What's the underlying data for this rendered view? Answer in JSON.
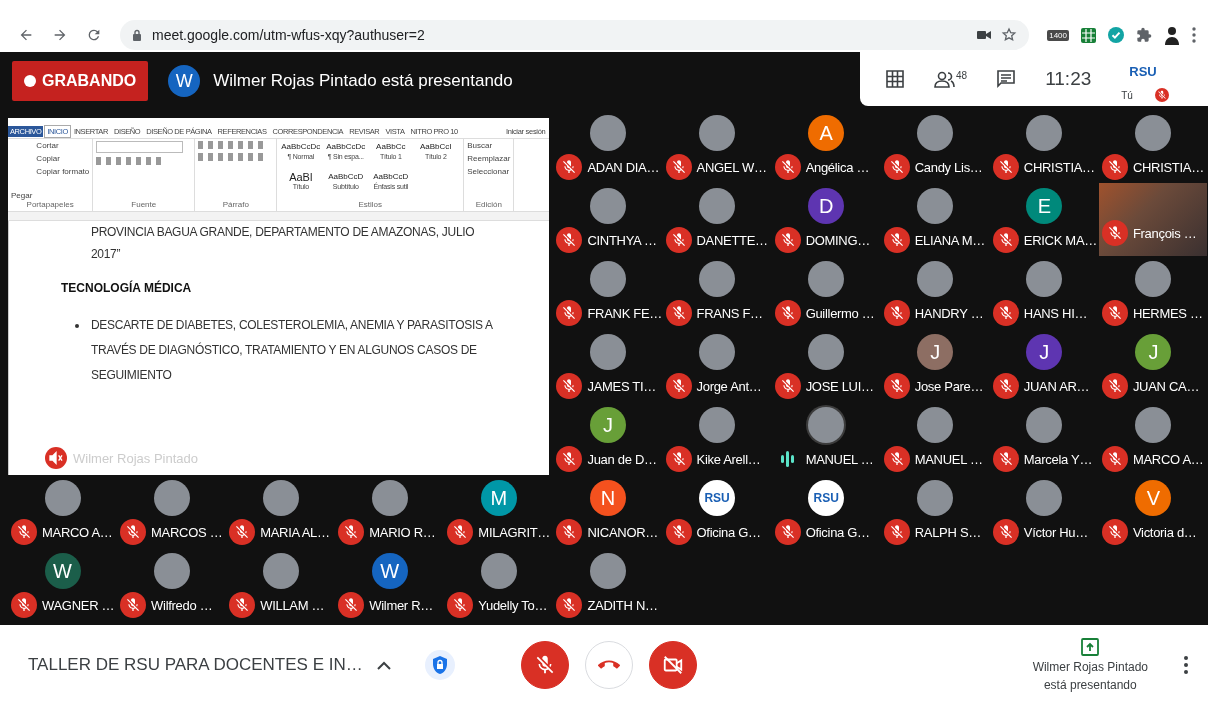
{
  "browser": {
    "url": "meet.google.com/utm-wfus-xqy?authuser=2",
    "extension_badge": "1400"
  },
  "header": {
    "recording_label": "GRABANDO",
    "presenter_initial": "W",
    "presenting_text": "Wilmer Rojas Pintado está presentando",
    "people_count": "48",
    "time": "11:23",
    "self_logo": "RSU",
    "self_label": "Tú",
    "self_muted": true
  },
  "presentation": {
    "tabs": [
      {
        "label": "ARCHIVO",
        "kind": "backstage",
        "selected": false
      },
      {
        "label": "INICIO",
        "kind": "tab",
        "selected": true
      },
      {
        "label": "INSERTAR",
        "kind": "tab",
        "selected": false
      },
      {
        "label": "DISEÑO",
        "kind": "tab",
        "selected": false
      },
      {
        "label": "DISEÑO DE PÁGINA",
        "kind": "tab",
        "selected": false
      },
      {
        "label": "REFERENCIAS",
        "kind": "tab",
        "selected": false
      },
      {
        "label": "CORRESPONDENCIA",
        "kind": "tab",
        "selected": false
      },
      {
        "label": "REVISAR",
        "kind": "tab",
        "selected": false
      },
      {
        "label": "VISTA",
        "kind": "tab",
        "selected": false
      },
      {
        "label": "NITRO PRO 10",
        "kind": "tab",
        "selected": false
      }
    ],
    "sign_in": "Iniciar sesión",
    "clipboard": {
      "paste": "Pegar",
      "items": [
        "Cortar",
        "Copiar",
        "Copiar formato"
      ]
    },
    "styles": [
      {
        "sample": "AaBbCcDc",
        "name": "¶ Normal"
      },
      {
        "sample": "AaBbCcDc",
        "name": "¶ Sin espa..."
      },
      {
        "sample": "AaBbCc",
        "name": "Título 1"
      },
      {
        "sample": "AaBbCcI",
        "name": "Título 2"
      },
      {
        "sample": "AaBl",
        "name": "Título"
      },
      {
        "sample": "AaBbCcD",
        "name": "Subtítulo"
      },
      {
        "sample": "AaBbCcD",
        "name": "Énfasis sutil"
      }
    ],
    "editing": [
      "Buscar",
      "Reemplazar",
      "Seleccionar"
    ],
    "groups": [
      "Portapapeles",
      "Fuente",
      "Párrafo",
      "Estilos",
      "Edición"
    ],
    "document": {
      "lines": [
        "PROVINCIA BAGUA GRANDE, DEPARTAMENTO DE AMAZONAS, JULIO",
        "2017”"
      ],
      "heading": "TECNOLOGÍA MÉDICA",
      "bullets": [
        "DESCARTE DE DIABETES, COLESTEROLEMIA, ANEMIA Y PARASITOSIS A TRAVÉS DE DIAGNÓSTICO, TRATAMIENTO Y EN ALGUNOS CASOS DE SEGUIMIENTO"
      ]
    },
    "presenter_name": "Wilmer Rojas Pintado",
    "presenter_muted": true
  },
  "participants": [
    {
      "name": "ADAN DIA…",
      "kind": "photo",
      "muted": true
    },
    {
      "name": "ANGEL W…",
      "kind": "photo",
      "muted": true
    },
    {
      "name": "Angélica …",
      "kind": "letter",
      "initial": "A",
      "color": "#ef6c00",
      "muted": true
    },
    {
      "name": "Candy Lis…",
      "kind": "photo",
      "muted": true
    },
    {
      "name": "CHRISTIA…",
      "kind": "photo",
      "muted": true
    },
    {
      "name": "CHRISTIA…",
      "kind": "photo",
      "muted": true
    },
    {
      "name": "CINTHYA …",
      "kind": "photo",
      "muted": true
    },
    {
      "name": "DANETTE…",
      "kind": "photo",
      "muted": true
    },
    {
      "name": "DOMING…",
      "kind": "letter",
      "initial": "D",
      "color": "#5e35b1",
      "muted": true
    },
    {
      "name": "ELIANA M…",
      "kind": "photo",
      "muted": true
    },
    {
      "name": "ERICK MA…",
      "kind": "letter",
      "initial": "E",
      "color": "#00897b",
      "muted": true
    },
    {
      "name": "François …",
      "kind": "video",
      "muted": true
    },
    {
      "name": "FRANK FE…",
      "kind": "photo",
      "muted": true
    },
    {
      "name": "FRANS F…",
      "kind": "photo",
      "muted": true
    },
    {
      "name": "Guillermo …",
      "kind": "photo",
      "muted": true
    },
    {
      "name": "HANDRY …",
      "kind": "photo",
      "muted": true
    },
    {
      "name": "HANS HI…",
      "kind": "photo",
      "muted": true
    },
    {
      "name": "HERMES …",
      "kind": "photo",
      "muted": true
    },
    {
      "name": "JAMES TI…",
      "kind": "photo",
      "muted": true
    },
    {
      "name": "Jorge Ant…",
      "kind": "photo",
      "muted": true
    },
    {
      "name": "JOSE LUI…",
      "kind": "photo",
      "muted": true
    },
    {
      "name": "Jose Pare…",
      "kind": "letter",
      "initial": "J",
      "color": "#8d6e63",
      "muted": true
    },
    {
      "name": "JUAN AR…",
      "kind": "letter",
      "initial": "J",
      "color": "#5e35b1",
      "muted": true
    },
    {
      "name": "JUAN CA…",
      "kind": "letter",
      "initial": "J",
      "color": "#689f38",
      "muted": true
    },
    {
      "name": "Juan de D…",
      "kind": "letter",
      "initial": "J",
      "color": "#689f38",
      "muted": true
    },
    {
      "name": "Kike Arell…",
      "kind": "photo",
      "muted": true
    },
    {
      "name": "MANUEL …",
      "kind": "photo",
      "muted": false
    },
    {
      "name": "MANUEL …",
      "kind": "photo",
      "muted": true
    },
    {
      "name": "Marcela Y…",
      "kind": "photo",
      "muted": true
    },
    {
      "name": "MARCO A…",
      "kind": "photo",
      "muted": true
    },
    {
      "name": "MARCO A…",
      "kind": "photo",
      "muted": true
    },
    {
      "name": "MARCOS …",
      "kind": "photo",
      "muted": true
    },
    {
      "name": "MARIA AL…",
      "kind": "photo",
      "muted": true
    },
    {
      "name": "MARIO R…",
      "kind": "photo",
      "muted": true
    },
    {
      "name": "MILAGRIT…",
      "kind": "letter",
      "initial": "M",
      "color": "#0097a7",
      "muted": true
    },
    {
      "name": "NICANOR…",
      "kind": "letter",
      "initial": "N",
      "color": "#f4511e",
      "muted": true
    },
    {
      "name": "Oficina G…",
      "kind": "logo",
      "logo_text": "RSU",
      "muted": true
    },
    {
      "name": "Oficina G…",
      "kind": "logo",
      "logo_text": "RSU",
      "muted": true
    },
    {
      "name": "RALPH S…",
      "kind": "photo",
      "muted": true
    },
    {
      "name": "Víctor Hu…",
      "kind": "photo",
      "muted": true
    },
    {
      "name": "Victoria d…",
      "kind": "letter",
      "initial": "V",
      "color": "#ef6c00",
      "muted": true
    },
    {
      "name": "WAGNER …",
      "kind": "letter",
      "initial": "W",
      "color": "#1b5e4a",
      "muted": true
    },
    {
      "name": "Wilfredo …",
      "kind": "photo",
      "muted": true
    },
    {
      "name": "WILLAM …",
      "kind": "photo",
      "muted": true
    },
    {
      "name": "Wilmer R…",
      "kind": "letter",
      "initial": "W",
      "color": "#1565c0",
      "muted": true
    },
    {
      "name": "Yudelly To…",
      "kind": "photo",
      "muted": true
    },
    {
      "name": "ZADITH N…",
      "kind": "photo",
      "muted": true
    }
  ],
  "bottom_bar": {
    "meeting_title": "TALLER DE RSU PARA DOCENTES E IN…",
    "mic_on": false,
    "camera_on": false,
    "presenting_lines": [
      "Wilmer Rojas Pintado",
      "está presentando"
    ]
  }
}
